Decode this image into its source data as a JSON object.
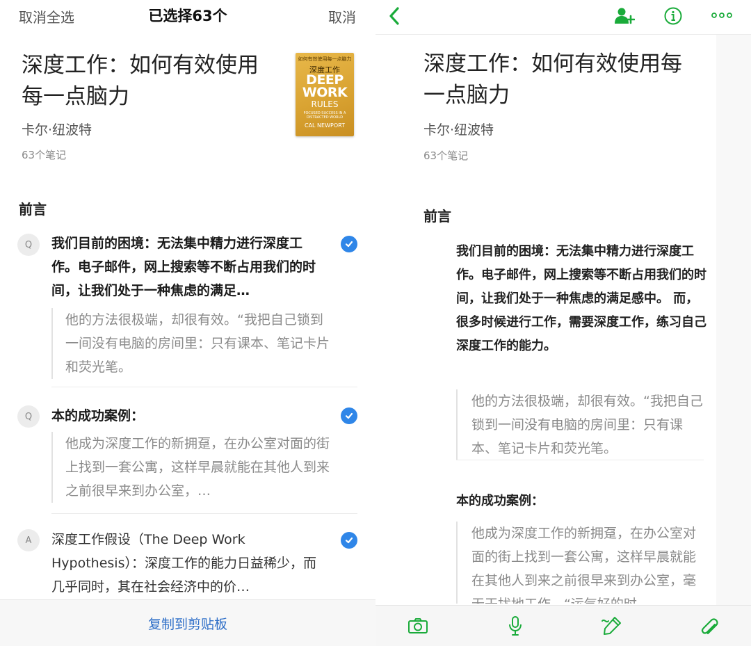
{
  "left": {
    "topbar": {
      "cancel_all": "取消全选",
      "selected": "已选择63个",
      "cancel": "取消"
    },
    "book": {
      "title": "深度工作：如何有效使用每一点脑力",
      "author": "卡尔·纽波特",
      "note_count": "63个笔记",
      "cover": {
        "top_text": "如何有效使用每一点脑力",
        "cn_title": "深度工作",
        "line1": "DEEP",
        "line2": "WORK",
        "line3": "RULES",
        "subtitle": "FOCUSED SUCCESS IN A DISTRACTED WORLD",
        "author": "CAL NEWPORT"
      }
    },
    "section": "前言",
    "notes": [
      {
        "title": "我们目前的困境：无法集中精力进行深度工作。电子邮件，网上搜索等不断占用我们的时间，让我们处于一种焦虑的满足…",
        "quote": "他的方法很极端，却很有效。“我把自己锁到一间没有电脑的房间里：只有课本、笔记卡片和荧光笔。",
        "icon": "Q"
      },
      {
        "title": "本的成功案例：",
        "quote": "他成为深度工作的新拥趸，在办公室对面的街上找到一套公寓，这样早晨就能在其他人到来之前很早来到办公室，…",
        "icon": "Q"
      },
      {
        "title": "深度工作假设（The Deep Work Hypothesis）：深度工作的能力日益稀少，而几乎同时，其在社会经济中的价…",
        "icon": "A"
      }
    ],
    "bottom_action": "复制到剪贴板"
  },
  "right": {
    "book": {
      "title": "深度工作：如何有效使用每一点脑力",
      "author": "卡尔·纽波特",
      "note_count": "63个笔记"
    },
    "section": "前言",
    "notes": [
      {
        "title": "我们目前的困境：无法集中精力进行深度工作。电子邮件，网上搜索等不断占用我们的时间，让我们处于一种焦虑的满足感中。 而，很多时候进行工作，需要深度工作，练习自己深度工作的能力。",
        "quote": "他的方法很极端，却很有效。“我把自己锁到一间没有电脑的房间里：只有课本、笔记卡片和荧光笔。"
      },
      {
        "title": "本的成功案例：",
        "quote": "他成为深度工作的新拥趸，在办公室对面的街上找到一套公寓，这样早晨就能在其他人到来之前很早来到办公室，毫无干扰地工作。“运气好的时"
      }
    ]
  },
  "colors": {
    "accent_green": "#1aab3a",
    "check_blue": "#2f86e8",
    "link_blue": "#2f6fc8"
  }
}
